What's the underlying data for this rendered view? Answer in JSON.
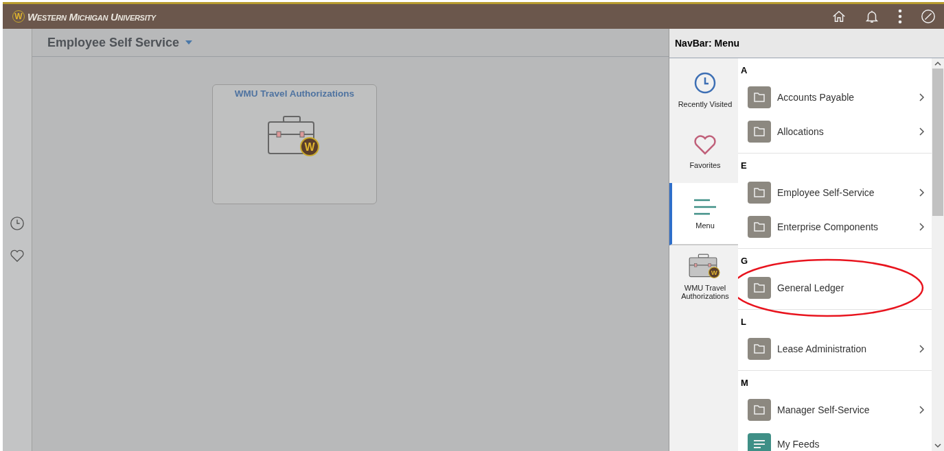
{
  "header": {
    "logo_letter": "W",
    "title": "Western Michigan University"
  },
  "header_icons": [
    {
      "kind": "home"
    },
    {
      "kind": "bell"
    },
    {
      "kind": "more"
    },
    {
      "kind": "compass"
    }
  ],
  "left_rail": [
    {
      "kind": "clock"
    },
    {
      "kind": "heart"
    }
  ],
  "page": {
    "title": "Employee Self Service"
  },
  "tiles": [
    {
      "title": "WMU Travel Authorizations",
      "badge": "W"
    }
  ],
  "navbar": {
    "title": "NavBar: Menu",
    "tabs": [
      {
        "label": "Recently Visited",
        "kind": "clock",
        "selected": false
      },
      {
        "label": "Favorites",
        "kind": "heart",
        "selected": false
      },
      {
        "label": "Menu",
        "kind": "menu",
        "selected": true
      },
      {
        "label": "WMU Travel Authorizations",
        "kind": "briefcase",
        "badge": "W",
        "selected": false
      }
    ],
    "sections": [
      {
        "letter": "A",
        "items": [
          {
            "label": "Accounts Payable",
            "kind": "folder",
            "has_submenu": true,
            "circled": false
          },
          {
            "label": "Allocations",
            "kind": "folder",
            "has_submenu": true,
            "circled": false
          }
        ]
      },
      {
        "letter": "E",
        "items": [
          {
            "label": "Employee Self-Service",
            "kind": "folder",
            "has_submenu": true,
            "circled": false
          },
          {
            "label": "Enterprise Components",
            "kind": "folder",
            "has_submenu": true,
            "circled": false
          }
        ]
      },
      {
        "letter": "G",
        "items": [
          {
            "label": "General Ledger",
            "kind": "folder",
            "has_submenu": false,
            "circled": true
          }
        ]
      },
      {
        "letter": "L",
        "items": [
          {
            "label": "Lease Administration",
            "kind": "folder",
            "has_submenu": true,
            "circled": false
          }
        ]
      },
      {
        "letter": "M",
        "items": [
          {
            "label": "Manager Self-Service",
            "kind": "folder",
            "has_submenu": true,
            "circled": false
          },
          {
            "label": "My Feeds",
            "kind": "feed",
            "has_submenu": false,
            "circled": false
          }
        ]
      }
    ]
  }
}
